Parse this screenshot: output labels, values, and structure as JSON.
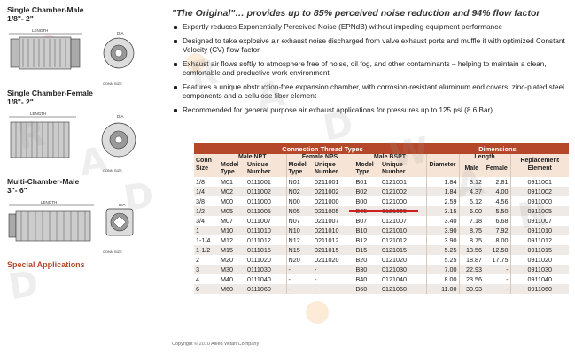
{
  "left": {
    "sections": [
      {
        "title_line1": "Single Chamber-Male",
        "title_line2": "1/8\"- 2\"",
        "length_label": "LENGTH",
        "dia_label": "DIA",
        "conn_label": "CONN SIZE"
      },
      {
        "title_line1": "Single Chamber-Female",
        "title_line2": "1/8\"- 2\"",
        "length_label": "LENGTH",
        "dia_label": "DIA",
        "conn_label": "CONN SIZE"
      },
      {
        "title_line1": "Multi-Chamber-Male",
        "title_line2": "3\"- 6\"",
        "length_label": "LENGTH",
        "dia_label": "DIA",
        "conn_label": "CONN SIZE"
      }
    ],
    "special_link": "Special Applications"
  },
  "headline": "\"The Original\"… provides up to 85% perceived noise reduction and 94% flow factor",
  "bullets": [
    "Expertly reduces Exponentially Perceived Noise (EPNdB) without impeding equipment performance",
    "Designed to take explosive air exhaust noise discharged from valve exhaust ports and muffle it with optimized Constant Velocity (CV) flow factor",
    "Exhaust air flows softly to atmosphere free of noise, oil fog, and other contaminants – helping to maintain a clean, comfortable and productive work environment",
    "Features a unique obstruction-free expansion chamber, with corrosion-resistant aluminum end covers, zinc-plated steel components and a cellulose fiber element",
    "Recommended for general purpose air exhaust applications for pressures up to 125 psi (8.6 Bar)"
  ],
  "table": {
    "group_conn": "Connection Thread Types",
    "group_dim": "Dimensions",
    "h_conn_size": "Conn Size",
    "h_male_npt": "Male NPT",
    "h_female_nps": "Female NPS",
    "h_male_bspt": "Male BSPT",
    "h_diameter": "Diameter",
    "h_length": "Length",
    "h_replacement": "Replacement Element",
    "h_model_type": "Model Type",
    "h_unique_number": "Unique Number",
    "h_male": "Male",
    "h_female": "Female",
    "rows": [
      {
        "size": "1/8",
        "npt_m": "M01",
        "npt_n": "0111001",
        "nps_m": "N01",
        "nps_n": "0211001",
        "bspt_m": "B01",
        "bspt_n": "0121001",
        "dia": "1.84",
        "len_m": "3.12",
        "len_f": "2.81",
        "rep": "0911001"
      },
      {
        "size": "1/4",
        "npt_m": "M02",
        "npt_n": "0111002",
        "nps_m": "N02",
        "nps_n": "0211002",
        "bspt_m": "B02",
        "bspt_n": "0121002",
        "dia": "1.84",
        "len_m": "4.37",
        "len_f": "4.00",
        "rep": "0911002"
      },
      {
        "size": "3/8",
        "npt_m": "M00",
        "npt_n": "0111000",
        "nps_m": "N00",
        "nps_n": "0211000",
        "bspt_m": "B00",
        "bspt_n": "0121000",
        "dia": "2.59",
        "len_m": "5.12",
        "len_f": "4.56",
        "rep": "0911000"
      },
      {
        "size": "1/2",
        "npt_m": "M05",
        "npt_n": "0111005",
        "nps_m": "N05",
        "nps_n": "0211005",
        "bspt_m": "B05",
        "bspt_n": "0121005",
        "dia": "3.15",
        "len_m": "6.00",
        "len_f": "5.50",
        "rep": "0911005"
      },
      {
        "size": "3/4",
        "npt_m": "M07",
        "npt_n": "0111007",
        "nps_m": "N07",
        "nps_n": "0211007",
        "bspt_m": "B07",
        "bspt_n": "0121007",
        "dia": "3.40",
        "len_m": "7.18",
        "len_f": "6.68",
        "rep": "0911007"
      },
      {
        "size": "1",
        "npt_m": "M10",
        "npt_n": "0111010",
        "nps_m": "N10",
        "nps_n": "0211010",
        "bspt_m": "B10",
        "bspt_n": "0121010",
        "dia": "3.90",
        "len_m": "8.75",
        "len_f": "7.92",
        "rep": "0911010"
      },
      {
        "size": "1-1/4",
        "npt_m": "M12",
        "npt_n": "0111012",
        "nps_m": "N12",
        "nps_n": "0211012",
        "bspt_m": "B12",
        "bspt_n": "0121012",
        "dia": "3.90",
        "len_m": "8.75",
        "len_f": "8.00",
        "rep": "0911012"
      },
      {
        "size": "1-1/2",
        "npt_m": "M15",
        "npt_n": "0111015",
        "nps_m": "N15",
        "nps_n": "0211015",
        "bspt_m": "B15",
        "bspt_n": "0121015",
        "dia": "5.25",
        "len_m": "13.56",
        "len_f": "12.50",
        "rep": "0911015"
      },
      {
        "size": "2",
        "npt_m": "M20",
        "npt_n": "0111020",
        "nps_m": "N20",
        "nps_n": "0211020",
        "bspt_m": "B20",
        "bspt_n": "0121020",
        "dia": "5.25",
        "len_m": "18.87",
        "len_f": "17.75",
        "rep": "0911020"
      },
      {
        "size": "3",
        "npt_m": "M30",
        "npt_n": "0111030",
        "nps_m": "-",
        "nps_n": "-",
        "bspt_m": "B30",
        "bspt_n": "0121030",
        "dia": "7.00",
        "len_m": "22.93",
        "len_f": "-",
        "rep": "0911030"
      },
      {
        "size": "4",
        "npt_m": "M40",
        "npt_n": "0111040",
        "nps_m": "-",
        "nps_n": "-",
        "bspt_m": "B40",
        "bspt_n": "0121040",
        "dia": "8.00",
        "len_m": "23.56",
        "len_f": "-",
        "rep": "0911040"
      },
      {
        "size": "6",
        "npt_m": "M60",
        "npt_n": "0111060",
        "nps_m": "-",
        "nps_n": "-",
        "bspt_m": "B60",
        "bspt_n": "0121060",
        "dia": "11.00",
        "len_m": "30.93",
        "len_f": "-",
        "rep": "0911060"
      }
    ]
  },
  "copyright": "Copyright © 2010 Allied Witan Company",
  "watermark": "RADWAND",
  "colors": {
    "accent": "#b5482a",
    "header_bg": "#f6e5d7",
    "row_alt": "#efeae6",
    "underline": "#cc2020"
  }
}
